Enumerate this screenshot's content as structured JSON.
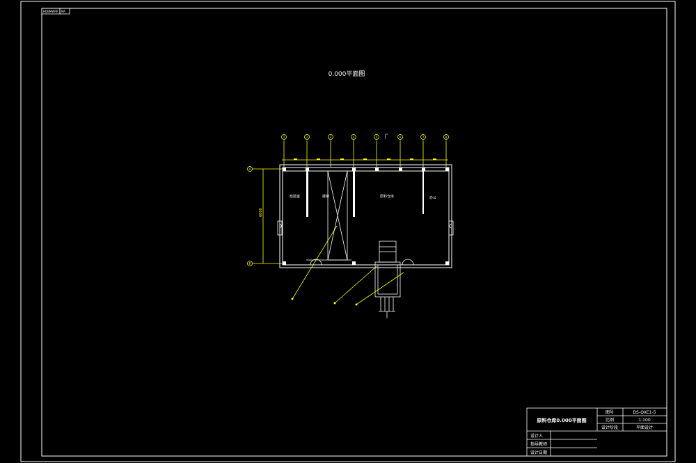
{
  "corner_tag": {
    "left": "HDBMWRR",
    "right": "NA"
  },
  "drawing_title": "0.000平面图",
  "axis_labels": [
    "1",
    "2",
    "3",
    "4",
    "5",
    "6",
    "7",
    "8"
  ],
  "row_labels": [
    "A",
    "B"
  ],
  "dimension_label": "6000",
  "rooms": {
    "room1": "检验室",
    "room2": "楼梯",
    "room3": "原料仓库",
    "room4": "办公"
  },
  "title_block": {
    "title": "原料仓库0.000平面图",
    "drawing_no_label": "图号",
    "drawing_no": "DS-QXC1-5",
    "scale_label": "比例",
    "scale": "1:100",
    "design_stage_label": "设计阶段",
    "design_stage": "平面设计",
    "designer_label": "设计人",
    "checker_label": "指导教师",
    "date_label": "设计日期"
  },
  "colors": {
    "line": "#ffffff",
    "axis": "#ffff00",
    "background": "#000000"
  }
}
